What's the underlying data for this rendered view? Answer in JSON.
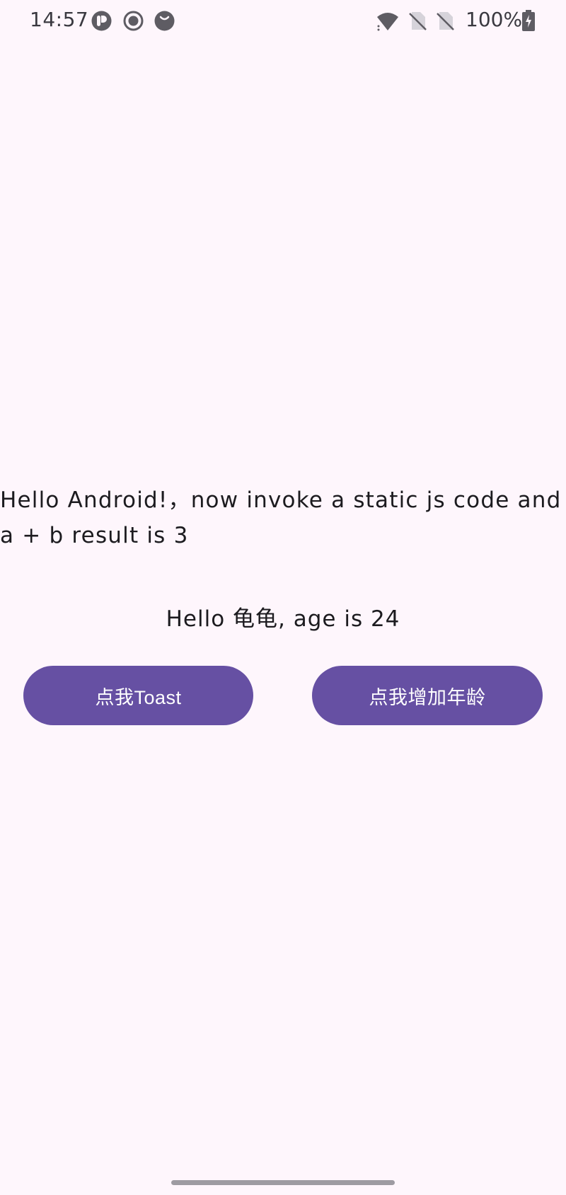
{
  "status_bar": {
    "time": "14:57",
    "battery": "100%",
    "left_icons": [
      "app-r-icon",
      "record-icon",
      "face-icon"
    ],
    "right_icons": [
      "wifi-icon",
      "no-sim-icon",
      "no-sim-icon",
      "battery-charging-icon"
    ]
  },
  "main": {
    "message": "Hello Android!，now invoke a static js code and a + b result is 3",
    "greeting": "Hello 龟龟, age is 24"
  },
  "buttons": {
    "toast_label": "点我Toast",
    "age_label": "点我增加年龄"
  },
  "colors": {
    "background": "#FEF6FC",
    "button": "#6650A3",
    "button_text": "#FFFFFF",
    "text": "#1C1B1F"
  }
}
